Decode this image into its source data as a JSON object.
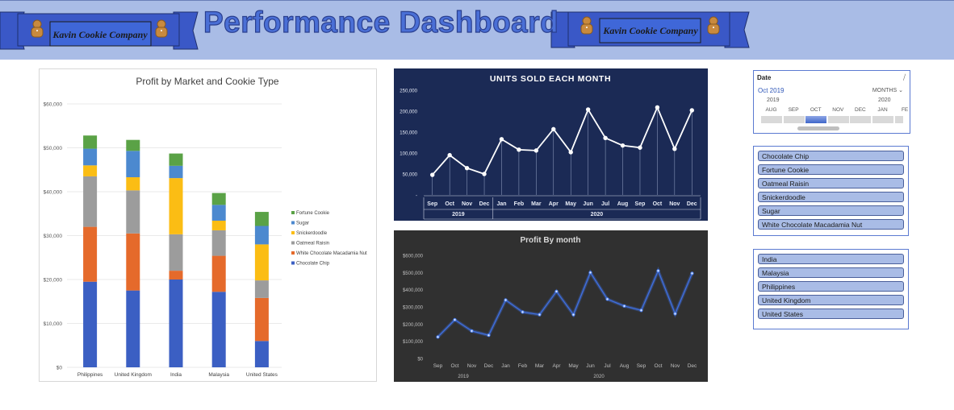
{
  "header": {
    "title": "Performance Dashboard",
    "banner_left_text": "Kavin Cookie Company",
    "banner_right_text": "Kavin Cookie Company",
    "logo_icon": "gingerbread-man-icon",
    "colors": {
      "band": "#a9bce6",
      "banner": "#3a58c7",
      "title": "#4a6fd6"
    }
  },
  "charts": {
    "profit_by_market": {
      "type": "bar",
      "stacked": true,
      "title": "Profit by Market and Cookie Type",
      "categories": [
        "Philippines",
        "United Kingdom",
        "India",
        "Malaysia",
        "United States"
      ],
      "yticks": [
        "$0",
        "$10,000",
        "$20,000",
        "$30,000",
        "$40,000",
        "$50,000",
        "$60,000"
      ],
      "ylim": [
        0,
        60000
      ],
      "legend_position": "right",
      "series": [
        {
          "name": "Chocolate Chip",
          "color": "#3b5fc3",
          "values": [
            19500,
            17500,
            20000,
            17200,
            6000
          ]
        },
        {
          "name": "White Chocolate Macadamia Nut",
          "color": "#e56a2b",
          "values": [
            12500,
            13000,
            2000,
            8200,
            9800
          ]
        },
        {
          "name": "Oatmeal Raisin",
          "color": "#9c9c9c",
          "values": [
            11500,
            9800,
            8300,
            5800,
            4000
          ]
        },
        {
          "name": "Snickerdoodle",
          "color": "#fbbd14",
          "values": [
            2500,
            3000,
            12800,
            2200,
            8200
          ]
        },
        {
          "name": "Sugar",
          "color": "#4c89cf",
          "values": [
            3800,
            6000,
            2800,
            3600,
            4200
          ]
        },
        {
          "name": "Fortune Cookie",
          "color": "#5aa246",
          "values": [
            3000,
            2500,
            2800,
            2700,
            3200
          ]
        }
      ],
      "legend_order": [
        "Fortune Cookie",
        "Sugar",
        "Snickerdoodle",
        "Oatmeal Raisin",
        "White Chocolate Macadamia Nut",
        "Chocolate Chip"
      ]
    },
    "units_sold": {
      "type": "line",
      "title": "UNITS SOLD EACH MONTH",
      "months": [
        "Sep",
        "Oct",
        "Nov",
        "Dec",
        "Jan",
        "Feb",
        "Mar",
        "Apr",
        "May",
        "Jun",
        "Jul",
        "Aug",
        "Sep",
        "Oct",
        "Nov",
        "Dec"
      ],
      "year_groups": [
        {
          "label": "2019",
          "count": 4
        },
        {
          "label": "2020",
          "count": 12
        }
      ],
      "values": [
        48000,
        95000,
        64000,
        50000,
        133000,
        108000,
        106000,
        157000,
        102000,
        204000,
        136000,
        118000,
        113000,
        209000,
        110000,
        202000
      ],
      "yticks": [
        "-",
        "50,000",
        "100,000",
        "150,000",
        "200,000",
        "250,000"
      ],
      "ylim": [
        0,
        250000
      ]
    },
    "profit_by_month": {
      "type": "line",
      "title": "Profit By month",
      "months": [
        "Sep",
        "Oct",
        "Nov",
        "Dec",
        "Jan",
        "Feb",
        "Mar",
        "Apr",
        "May",
        "Jun",
        "Jul",
        "Aug",
        "Sep",
        "Oct",
        "Nov",
        "Dec"
      ],
      "year_groups": [
        {
          "label": "2019",
          "count": 4
        },
        {
          "label": "2020",
          "count": 12
        }
      ],
      "values": [
        125000,
        225000,
        160000,
        135000,
        340000,
        270000,
        255000,
        390000,
        255000,
        500000,
        345000,
        305000,
        280000,
        510000,
        260000,
        495000
      ],
      "yticks": [
        "$0",
        "$100,000",
        "$200,000",
        "$300,000",
        "$400,000",
        "$500,000",
        "$600,000"
      ],
      "ylim": [
        0,
        600000
      ]
    }
  },
  "date_slicer": {
    "header": "Date",
    "clear_icon": "clear-filter-icon",
    "selection": "Oct 2019",
    "level": "MONTHS ⌄",
    "year_2019": "2019",
    "year_2020": "2020",
    "months": [
      "AUG",
      "SEP",
      "OCT",
      "NOV",
      "DEC",
      "JAN",
      "FE"
    ],
    "selected_month": "OCT"
  },
  "cookie_slicer": {
    "items": [
      "Chocolate Chip",
      "Fortune Cookie",
      "Oatmeal Raisin",
      "Snickerdoodle",
      "Sugar",
      "White Chocolate Macadamia Nut"
    ]
  },
  "country_slicer": {
    "items": [
      "India",
      "Malaysia",
      "Philippines",
      "United Kingdom",
      "United States"
    ]
  }
}
